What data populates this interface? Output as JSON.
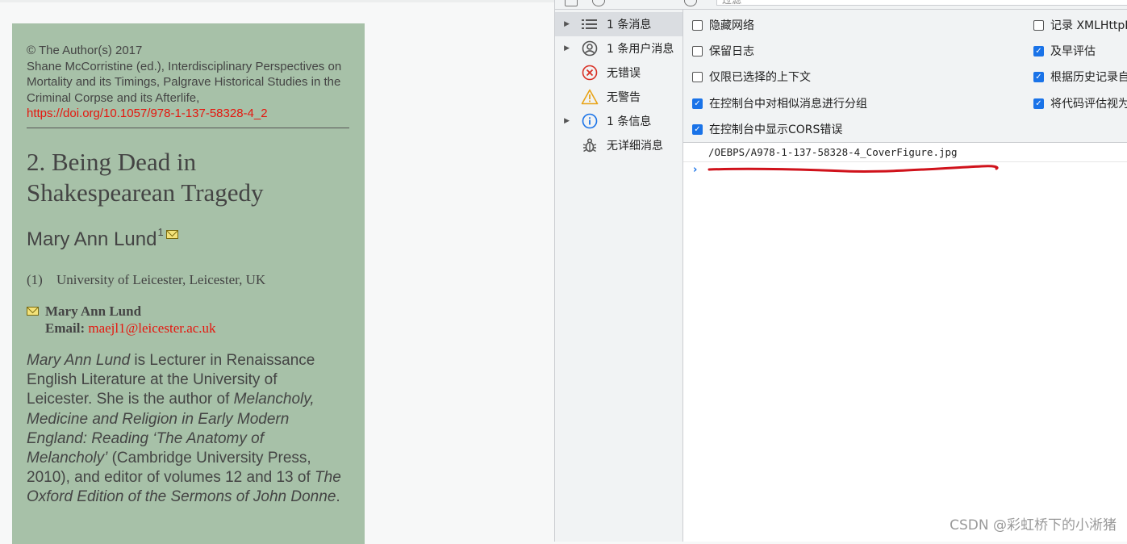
{
  "reader": {
    "copyright": "© The Author(s) 2017",
    "citation": "Shane McCorristine (ed.), Interdisciplinary Perspectives on Mortality and its Timings, Palgrave Historical Studies in the Criminal Corpse and its Afterlife,",
    "doi": "https://doi.org/10.1057/978-1-137-58328-4_2",
    "chapter_title_line1": "2. Being Dead in",
    "chapter_title_line2": "Shakespearean Tragedy",
    "author": "Mary Ann Lund",
    "author_sup": "1",
    "affil_num": "(1)",
    "affiliation": "University of Leicester, Leicester, UK",
    "contact_name": "Mary Ann Lund",
    "email_label": "Email:",
    "email": "maejl1@leicester.ac.uk",
    "bio": {
      "name": "Mary Ann Lund",
      "t1": " is Lecturer in Renaissance English Literature at the University of Leicester. She is the author of ",
      "book1": "Melancholy, Medicine and Religion in Early Modern England: Reading ‘The Anatomy of Melancholy’",
      "t2": " (Cambridge University Press, 2010), and editor of volumes 12 and 13 of ",
      "book2": "The Oxford Edition of the Sermons of John Donne",
      "t3": "."
    }
  },
  "devtools": {
    "filter_placeholder": "过滤",
    "sidebar": [
      {
        "label": "1 条消息",
        "icon": "list-icon",
        "expandable": true,
        "selected": true
      },
      {
        "label": "1 条用户消息",
        "icon": "user-icon",
        "expandable": true,
        "selected": false
      },
      {
        "label": "无错误",
        "icon": "error-icon",
        "expandable": false,
        "selected": false
      },
      {
        "label": "无警告",
        "icon": "warning-icon",
        "expandable": false,
        "selected": false
      },
      {
        "label": "1 条信息",
        "icon": "info-icon",
        "expandable": true,
        "selected": false
      },
      {
        "label": "无详细消息",
        "icon": "bug-icon",
        "expandable": false,
        "selected": false
      }
    ],
    "settings_left": [
      {
        "label": "隐藏网络",
        "checked": false
      },
      {
        "label": "保留日志",
        "checked": false
      },
      {
        "label": "仅限已选择的上下文",
        "checked": false
      },
      {
        "label": "在控制台中对相似消息进行分组",
        "checked": true
      },
      {
        "label": "在控制台中显示CORS错误",
        "checked": true
      }
    ],
    "settings_right": [
      {
        "label": "记录 XMLHttpRequest",
        "checked": false
      },
      {
        "label": "及早评估",
        "checked": true
      },
      {
        "label": "根据历史记录自动完成",
        "checked": true
      },
      {
        "label": "将代码评估视为用户操作",
        "checked": true
      }
    ],
    "log_message": "/OEBPS/A978-1-137-58328-4_CoverFigure.jpg",
    "prompt": "›",
    "colors": {
      "accent": "#1a73e8",
      "error": "#d93025",
      "warning": "#e8a317",
      "link": "#e5170f",
      "scribble": "#d0121b"
    }
  },
  "watermark": "CSDN @彩虹桥下的小淅猪"
}
